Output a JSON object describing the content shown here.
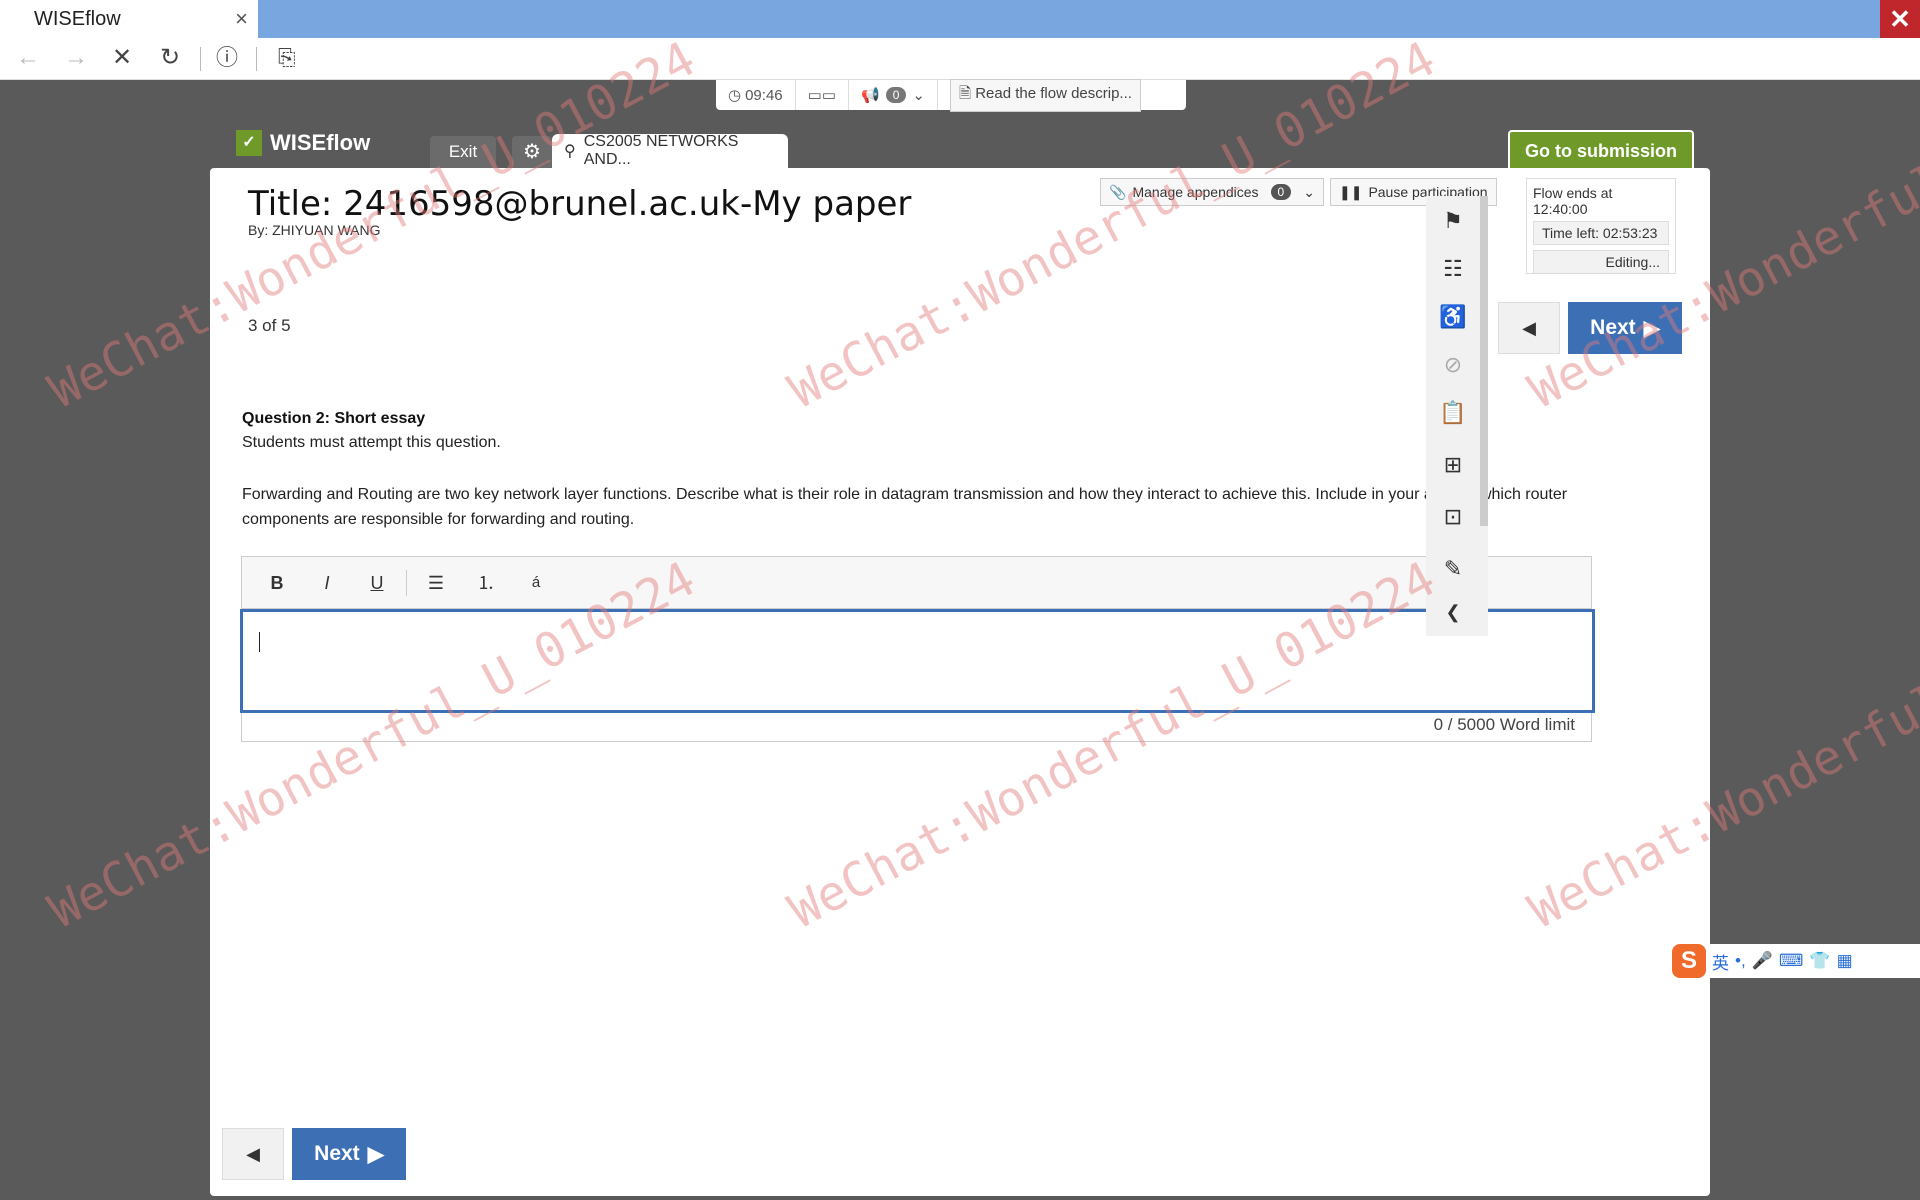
{
  "browser": {
    "tab_title": "WISEflow",
    "tab_close": "×",
    "window_close": "✕",
    "nav": {
      "back": "←",
      "forward": "→",
      "stop": "✕",
      "reload": "↻",
      "info": "ⓘ",
      "page": "⎘"
    }
  },
  "status_strip": {
    "clock": "09:46",
    "announcements_count": "0",
    "flow_description": "Read the flow descrip..."
  },
  "header": {
    "brand": "WISEflow",
    "exit_label": "Exit",
    "course_tab": "CS2005 NETWORKS AND...",
    "go_to_submission": "Go to submission"
  },
  "paper": {
    "title": "Title: 2416598@brunel.ac.uk-My paper",
    "by": "By: ZHIYUAN WANG",
    "manage_appendices": "Manage appendices",
    "appendices_count": "0",
    "pause_participation": "Pause participation",
    "flow_ends": "Flow ends at 12:40:00",
    "time_left": "Time left:  02:53:23",
    "editing": "Editing..."
  },
  "navigation": {
    "counter": "3 of 5",
    "next_label": "Next"
  },
  "question": {
    "title": "Question 2: Short essay",
    "subtitle": "Students must attempt this question.",
    "text": "Forwarding and Routing are two key network layer functions. Describe what is their role in datagram transmission and how they interact to achieve this. Include in your answer which router components are responsible for forwarding and routing."
  },
  "editor": {
    "word_count": "0  / 5000 Word limit",
    "toolbar": {
      "bold": "B",
      "italic": "I",
      "underline": "U",
      "bullets": "☰",
      "numbers": "⒈",
      "special": "á"
    }
  },
  "ime": {
    "logo": "S",
    "lang": "英"
  },
  "watermark": "WeChat:Wonderful_U_010224",
  "colors": {
    "accent_blue": "#3d6fb4",
    "brand_green": "#6f9a2a",
    "titlebar": "#7aa6e0"
  }
}
